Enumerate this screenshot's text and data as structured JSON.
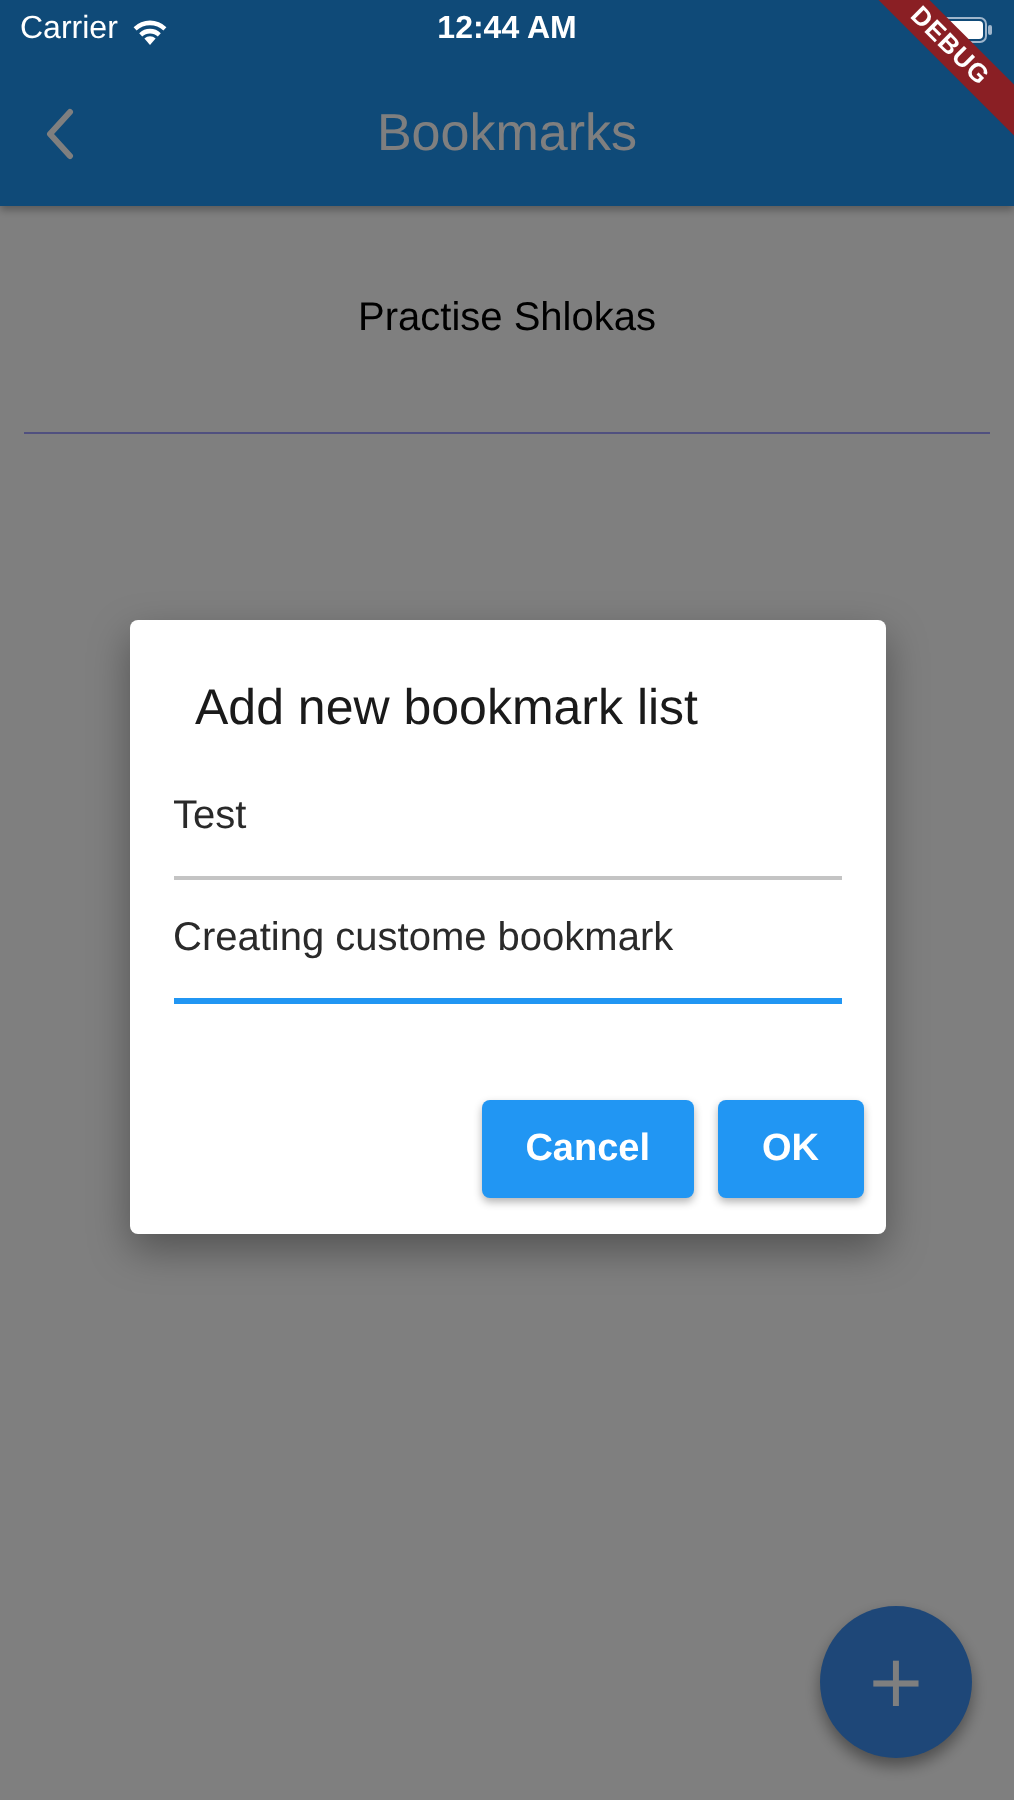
{
  "status_bar": {
    "carrier": "Carrier",
    "time": "12:44 AM"
  },
  "debug_banner": "DEBUG",
  "app_bar": {
    "title": "Bookmarks"
  },
  "list": [
    {
      "label": "Practise Shlokas"
    }
  ],
  "dialog": {
    "title": "Add new bookmark list",
    "fields": [
      {
        "value": "Test",
        "focused": false
      },
      {
        "value": "Creating custome bookmark",
        "focused": true
      }
    ],
    "buttons": [
      "Cancel",
      "OK"
    ]
  },
  "fab": {
    "label": "+"
  }
}
